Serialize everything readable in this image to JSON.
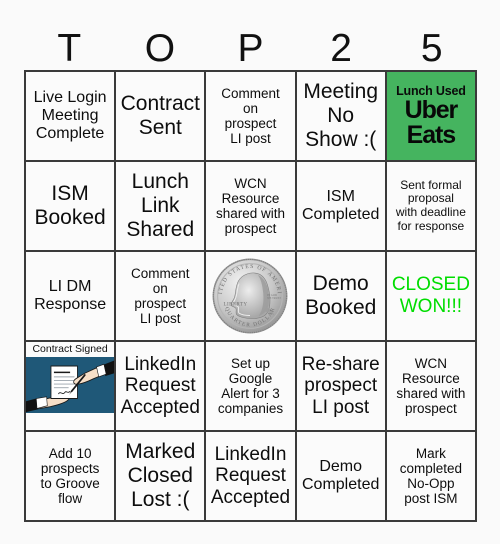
{
  "card": {
    "title_letters": [
      "T",
      "O",
      "P",
      "2",
      "5"
    ],
    "colors": {
      "highlight_green_bg": "#45b45f",
      "closed_won_green_text": "#00dd00",
      "grid_line": "#3a3a3a",
      "cell_bg": "#fbfbfb",
      "page_bg": "#fafafa",
      "contract_image_bg": "#1f5878"
    },
    "rows": [
      [
        {
          "type": "text",
          "text": "Live Login\nMeeting\nComplete",
          "name": "cell-live-login-meeting-complete",
          "size": "fs-md"
        },
        {
          "type": "text",
          "text": "Contract\nSent",
          "name": "cell-contract-sent",
          "size": "fs-xl"
        },
        {
          "type": "text",
          "text": "Comment\non\nprospect\nLI post",
          "name": "cell-comment-on-prospect-li-post",
          "size": "fs-sm"
        },
        {
          "type": "text",
          "text": "Meeting\nNo\nShow :(",
          "name": "cell-meeting-no-show",
          "size": "fs-xl"
        },
        {
          "type": "uber-eats",
          "name": "cell-lunch-used-uber-eats",
          "lunch_label": "Lunch Used",
          "uber": "Uber",
          "eats": "Eats"
        }
      ],
      [
        {
          "type": "text",
          "text": "ISM\nBooked",
          "name": "cell-ism-booked",
          "size": "fs-xl"
        },
        {
          "type": "text",
          "text": "Lunch\nLink\nShared",
          "name": "cell-lunch-link-shared",
          "size": "fs-xl"
        },
        {
          "type": "text",
          "text": "WCN\nResource\nshared with\nprospect",
          "name": "cell-wcn-resource-shared-with-prospect",
          "size": "fs-sm"
        },
        {
          "type": "text",
          "text": "ISM\nCompleted",
          "name": "cell-ism-completed",
          "size": "fs-md"
        },
        {
          "type": "text",
          "text": "Sent formal\nproposal\nwith deadline\nfor response",
          "name": "cell-sent-formal-proposal",
          "size": "fs-xs"
        }
      ],
      [
        {
          "type": "text",
          "text": "LI DM\nResponse",
          "name": "cell-li-dm-response",
          "size": "fs-md"
        },
        {
          "type": "text",
          "text": "Comment\non\nprospect\nLI post",
          "name": "cell-comment-on-prospect-li-post-2",
          "size": "fs-sm"
        },
        {
          "type": "quarter",
          "name": "cell-quarter-coin",
          "alt": "US quarter dollar coin",
          "inscriptions": [
            "UNITED STATES OF AMERICA",
            "LIBERTY",
            "IN GOD WE TRUST",
            "QUARTER DOLLAR"
          ]
        },
        {
          "type": "text",
          "text": "Demo\nBooked",
          "name": "cell-demo-booked",
          "size": "fs-xl"
        },
        {
          "type": "closed-won",
          "name": "cell-closed-won",
          "text": "CLOSED\nWON!!!"
        }
      ],
      [
        {
          "type": "contract",
          "name": "cell-contract-signed",
          "caption": "Contract Signed"
        },
        {
          "type": "text",
          "text": "LinkedIn\nRequest\nAccepted",
          "name": "cell-linkedin-request-accepted",
          "size": "fs-lg"
        },
        {
          "type": "text",
          "text": "Set up\nGoogle\nAlert for 3\ncompanies",
          "name": "cell-set-up-google-alert",
          "size": "fs-sm"
        },
        {
          "type": "text",
          "text": "Re-share\nprospect\nLI post",
          "name": "cell-re-share-prospect-li-post",
          "size": "fs-lg"
        },
        {
          "type": "text",
          "text": "WCN\nResource\nshared with\nprospect",
          "name": "cell-wcn-resource-shared-with-prospect-2",
          "size": "fs-sm"
        }
      ],
      [
        {
          "type": "text",
          "text": "Add 10\nprospects\nto Groove\nflow",
          "name": "cell-add-10-prospects-groove-flow",
          "size": "fs-sm"
        },
        {
          "type": "text",
          "text": "Marked\nClosed\nLost :(",
          "name": "cell-marked-closed-lost",
          "size": "fs-xl"
        },
        {
          "type": "text",
          "text": "LinkedIn\nRequest\nAccepted",
          "name": "cell-linkedin-request-accepted-2",
          "size": "fs-lg"
        },
        {
          "type": "text",
          "text": "Demo\nCompleted",
          "name": "cell-demo-completed",
          "size": "fs-md"
        },
        {
          "type": "text",
          "text": "Mark\ncompleted\nNo-Opp\npost ISM",
          "name": "cell-mark-completed-no-opp-post-ism",
          "size": "fs-sm"
        }
      ]
    ]
  }
}
